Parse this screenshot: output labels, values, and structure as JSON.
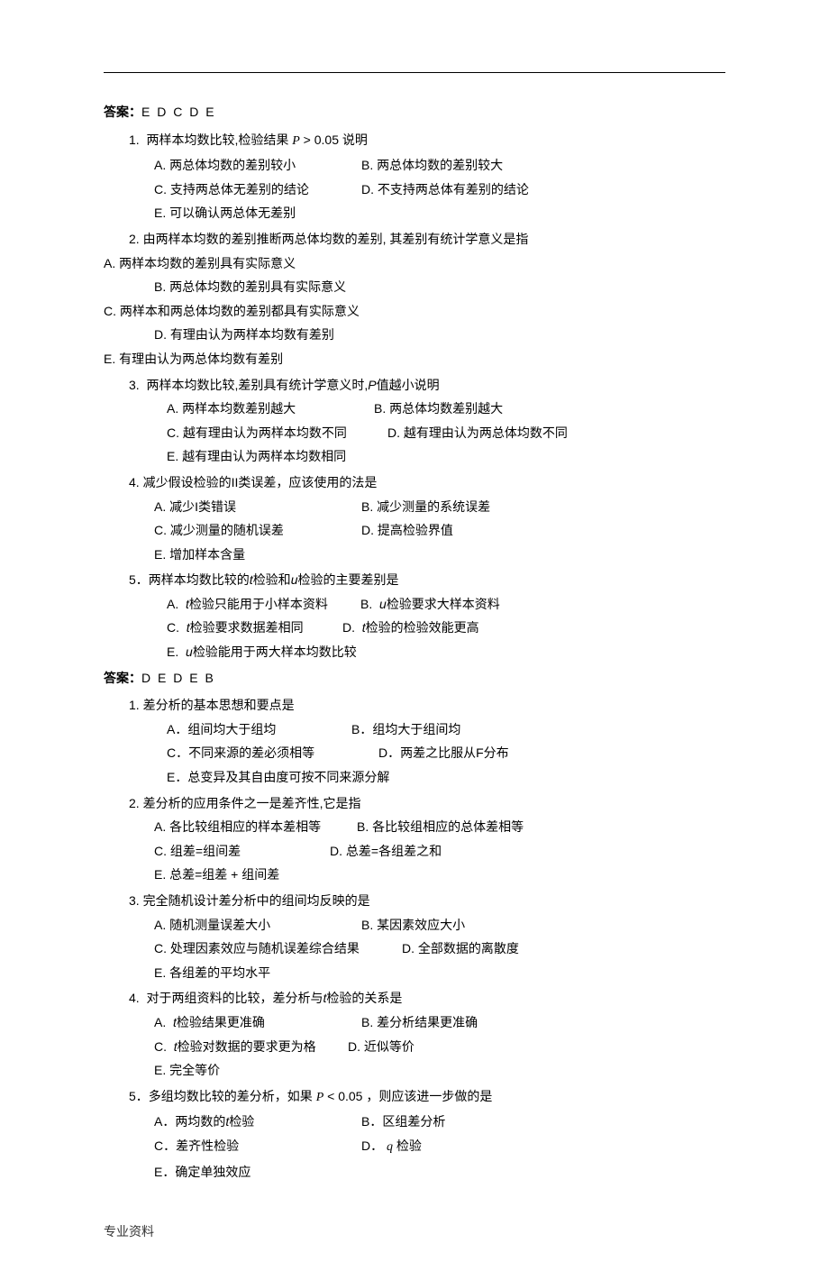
{
  "answer1": {
    "label": "答案：",
    "value": "E D C D E"
  },
  "section1": {
    "q1": {
      "stem": "1.  两样本均数比较,检验结果 P > 0.05 说明",
      "a": "A.  两总体均数的差别较小",
      "b": "B.  两总体均数的差别较大",
      "c": "C.  支持两总体无差别的结论",
      "d": "D.  不支持两总体有差别的结论",
      "e": "E.  可以确认两总体无差别"
    },
    "q2": {
      "stem": "2.  由两样本均数的差别推断两总体均数的差别,  其差别有统计学意义是指",
      "a": "A.  两样本均数的差别具有实际意义",
      "b": "B.  两总体均数的差别具有实际意义",
      "c": "C.  两样本和两总体均数的差别都具有实际意义",
      "d": "D.  有理由认为两样本均数有差别",
      "e": "E.  有理由认为两总体均数有差别"
    },
    "q3": {
      "stem": "3.  两样本均数比较,差别具有统计学意义时,P值越小说明",
      "a": "A.  两样本均数差别越大",
      "b": "B.  两总体均数差别越大",
      "c": "C.  越有理由认为两样本均数不同",
      "d": "D.  越有理由认为两总体均数不同",
      "e": "E.  越有理由认为两样本均数相同"
    },
    "q4": {
      "stem": "4.  减少假设检验的II类误差，应该使用的法是",
      "a": "A.  减少I类错误",
      "b": "B.  减少测量的系统误差",
      "c": "C.  减少测量的随机误差",
      "d": "D.  提高检验界值",
      "e": "E.  增加样本含量"
    },
    "q5": {
      "stem": "5．两样本均数比较的t检验和u检验的主要差别是",
      "a": "A.  t检验只能用于小样本资料",
      "b": "B.  u检验要求大样本资料",
      "c": "C.  t检验要求数据差相同",
      "d": "D.  t检验的检验效能更高",
      "e": "E.  u检验能用于两大样本均数比较"
    }
  },
  "answer2": {
    "label": "答案：",
    "value": "D E D E B"
  },
  "section2": {
    "q1": {
      "stem": "1.  差分析的基本思想和要点是",
      "a": "A．组间均大于组均",
      "b": "B．组均大于组间均",
      "c": "C．不同来源的差必须相等",
      "d": "D．两差之比服从F分布",
      "e": "E．总变异及其自由度可按不同来源分解"
    },
    "q2": {
      "stem": "2.  差分析的应用条件之一是差齐性,它是指",
      "a": "A.  各比较组相应的样本差相等",
      "b": "B.  各比较组相应的总体差相等",
      "c": "C.  组差=组间差",
      "d": "D.  总差=各组差之和",
      "e": "E.  总差=组差  +  组间差"
    },
    "q3": {
      "stem": "3.  完全随机设计差分析中的组间均反映的是",
      "a": "A.  随机测量误差大小",
      "b": "B.  某因素效应大小",
      "c": "C.  处理因素效应与随机误差综合结果",
      "d": "D.  全部数据的离散度",
      "e": "E.  各组差的平均水平"
    },
    "q4": {
      "stem": "4.  对于两组资料的比较，差分析与t检验的关系是",
      "a": "A.  t检验结果更准确",
      "b": "B.   差分析结果更准确",
      "c": "C.  t检验对数据的要求更为格",
      "d": "D.  近似等价",
      "e": "E.  完全等价"
    },
    "q5": {
      "stem": "5．多组均数比较的差分析，如果 P < 0.05 ，则应该进一步做的是",
      "a": "A．两均数的t检验",
      "b": "B．区组差分析",
      "c": "C．差齐性检验",
      "d": "D． q 检验",
      "e": "E．确定单独效应"
    }
  },
  "footer": "专业资料"
}
